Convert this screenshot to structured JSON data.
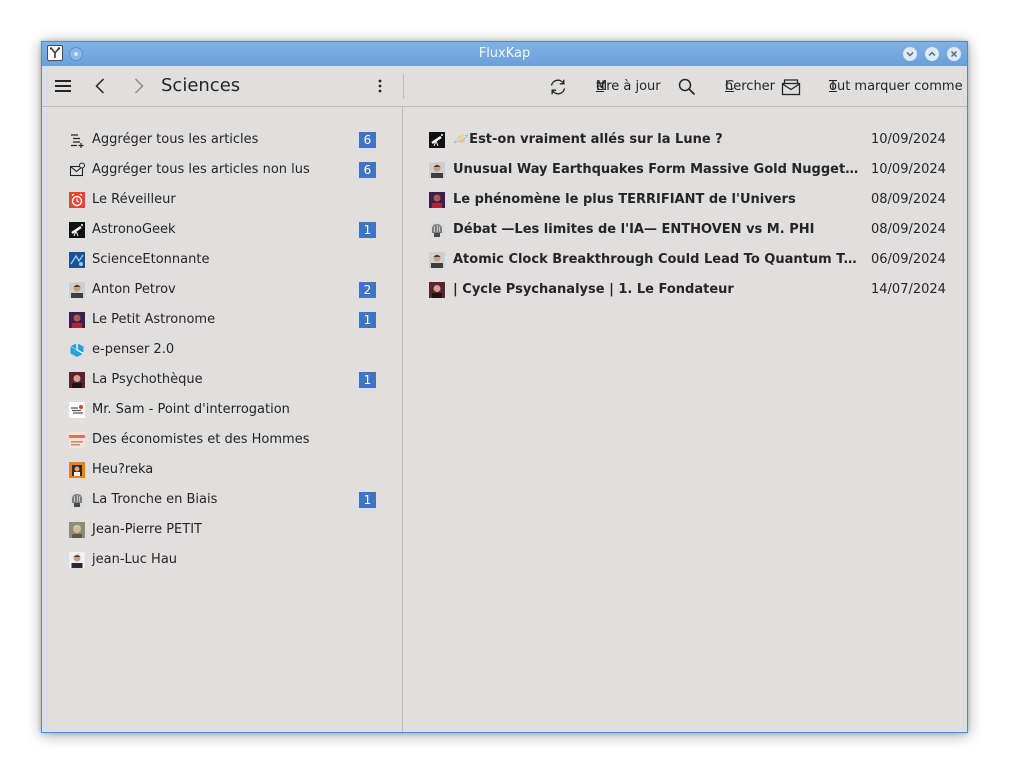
{
  "window": {
    "title": "FluxKap"
  },
  "toolbar": {
    "folder_title": "Sciences",
    "update_label": {
      "pre": "M",
      "key": "e",
      "post": "ttre à jour"
    },
    "search_label": {
      "key": "C",
      "post": "hercher"
    },
    "mark_all_label": {
      "key": "T",
      "post": "out marquer comme lu"
    }
  },
  "sidebar": {
    "feeds": [
      {
        "label": "Aggréger tous les articles",
        "badge": "6",
        "icon": "list-icon"
      },
      {
        "label": "Aggréger tous les articles non lus",
        "badge": "6",
        "icon": "unread-mail-icon"
      },
      {
        "label": "Le Réveilleur",
        "badge": "",
        "icon": "alarm-clock-avatar"
      },
      {
        "label": "AstronoGeek",
        "badge": "1",
        "icon": "telescope-avatar"
      },
      {
        "label": "ScienceEtonnante",
        "badge": "",
        "icon": "science-avatar"
      },
      {
        "label": "Anton Petrov",
        "badge": "2",
        "icon": "person-avatar"
      },
      {
        "label": "Le Petit Astronome",
        "badge": "1",
        "icon": "astronome-avatar"
      },
      {
        "label": "e-penser 2.0",
        "badge": "",
        "icon": "epenser-logo"
      },
      {
        "label": "La Psychothèque",
        "badge": "1",
        "icon": "psycho-avatar"
      },
      {
        "label": "Mr. Sam - Point d'interrogation",
        "badge": "",
        "icon": "mrsam-logo"
      },
      {
        "label": "Des économistes et des Hommes",
        "badge": "",
        "icon": "economists-logo"
      },
      {
        "label": "Heu?reka",
        "badge": "",
        "icon": "heureka-avatar"
      },
      {
        "label": "La Tronche en Biais",
        "badge": "1",
        "icon": "brain-avatar"
      },
      {
        "label": "Jean-Pierre PETIT",
        "badge": "",
        "icon": "person-avatar"
      },
      {
        "label": "jean-Luc Hau",
        "badge": "",
        "icon": "person-avatar"
      }
    ]
  },
  "articles": [
    {
      "title": "🪐Est-on vraiment allés sur la Lune ?",
      "date": "10/09/2024",
      "icon": "telescope-avatar"
    },
    {
      "title": "Unusual Way Earthquakes Form Massive Gold Nuggets Inside Quartz",
      "date": "10/09/2024",
      "icon": "person-avatar"
    },
    {
      "title": "Le phénomène le plus TERRIFIANT de l'Univers",
      "date": "08/09/2024",
      "icon": "astronome-avatar"
    },
    {
      "title": "Débat —Les limites de l'IA— ENTHOVEN vs M. PHI",
      "date": "08/09/2024",
      "icon": "brain-avatar"
    },
    {
      "title": "Atomic Clock Breakthrough Could Lead To Quantum Twin Paradox Test",
      "date": "06/09/2024",
      "icon": "person-avatar"
    },
    {
      "title": "| Cycle Psychanalyse | 1. Le Fondateur",
      "date": "14/07/2024",
      "icon": "psycho-avatar"
    }
  ],
  "colors": {
    "accent": "#3d75c4",
    "titlebar": "#6a9fd8",
    "background": "#e0dfde"
  }
}
